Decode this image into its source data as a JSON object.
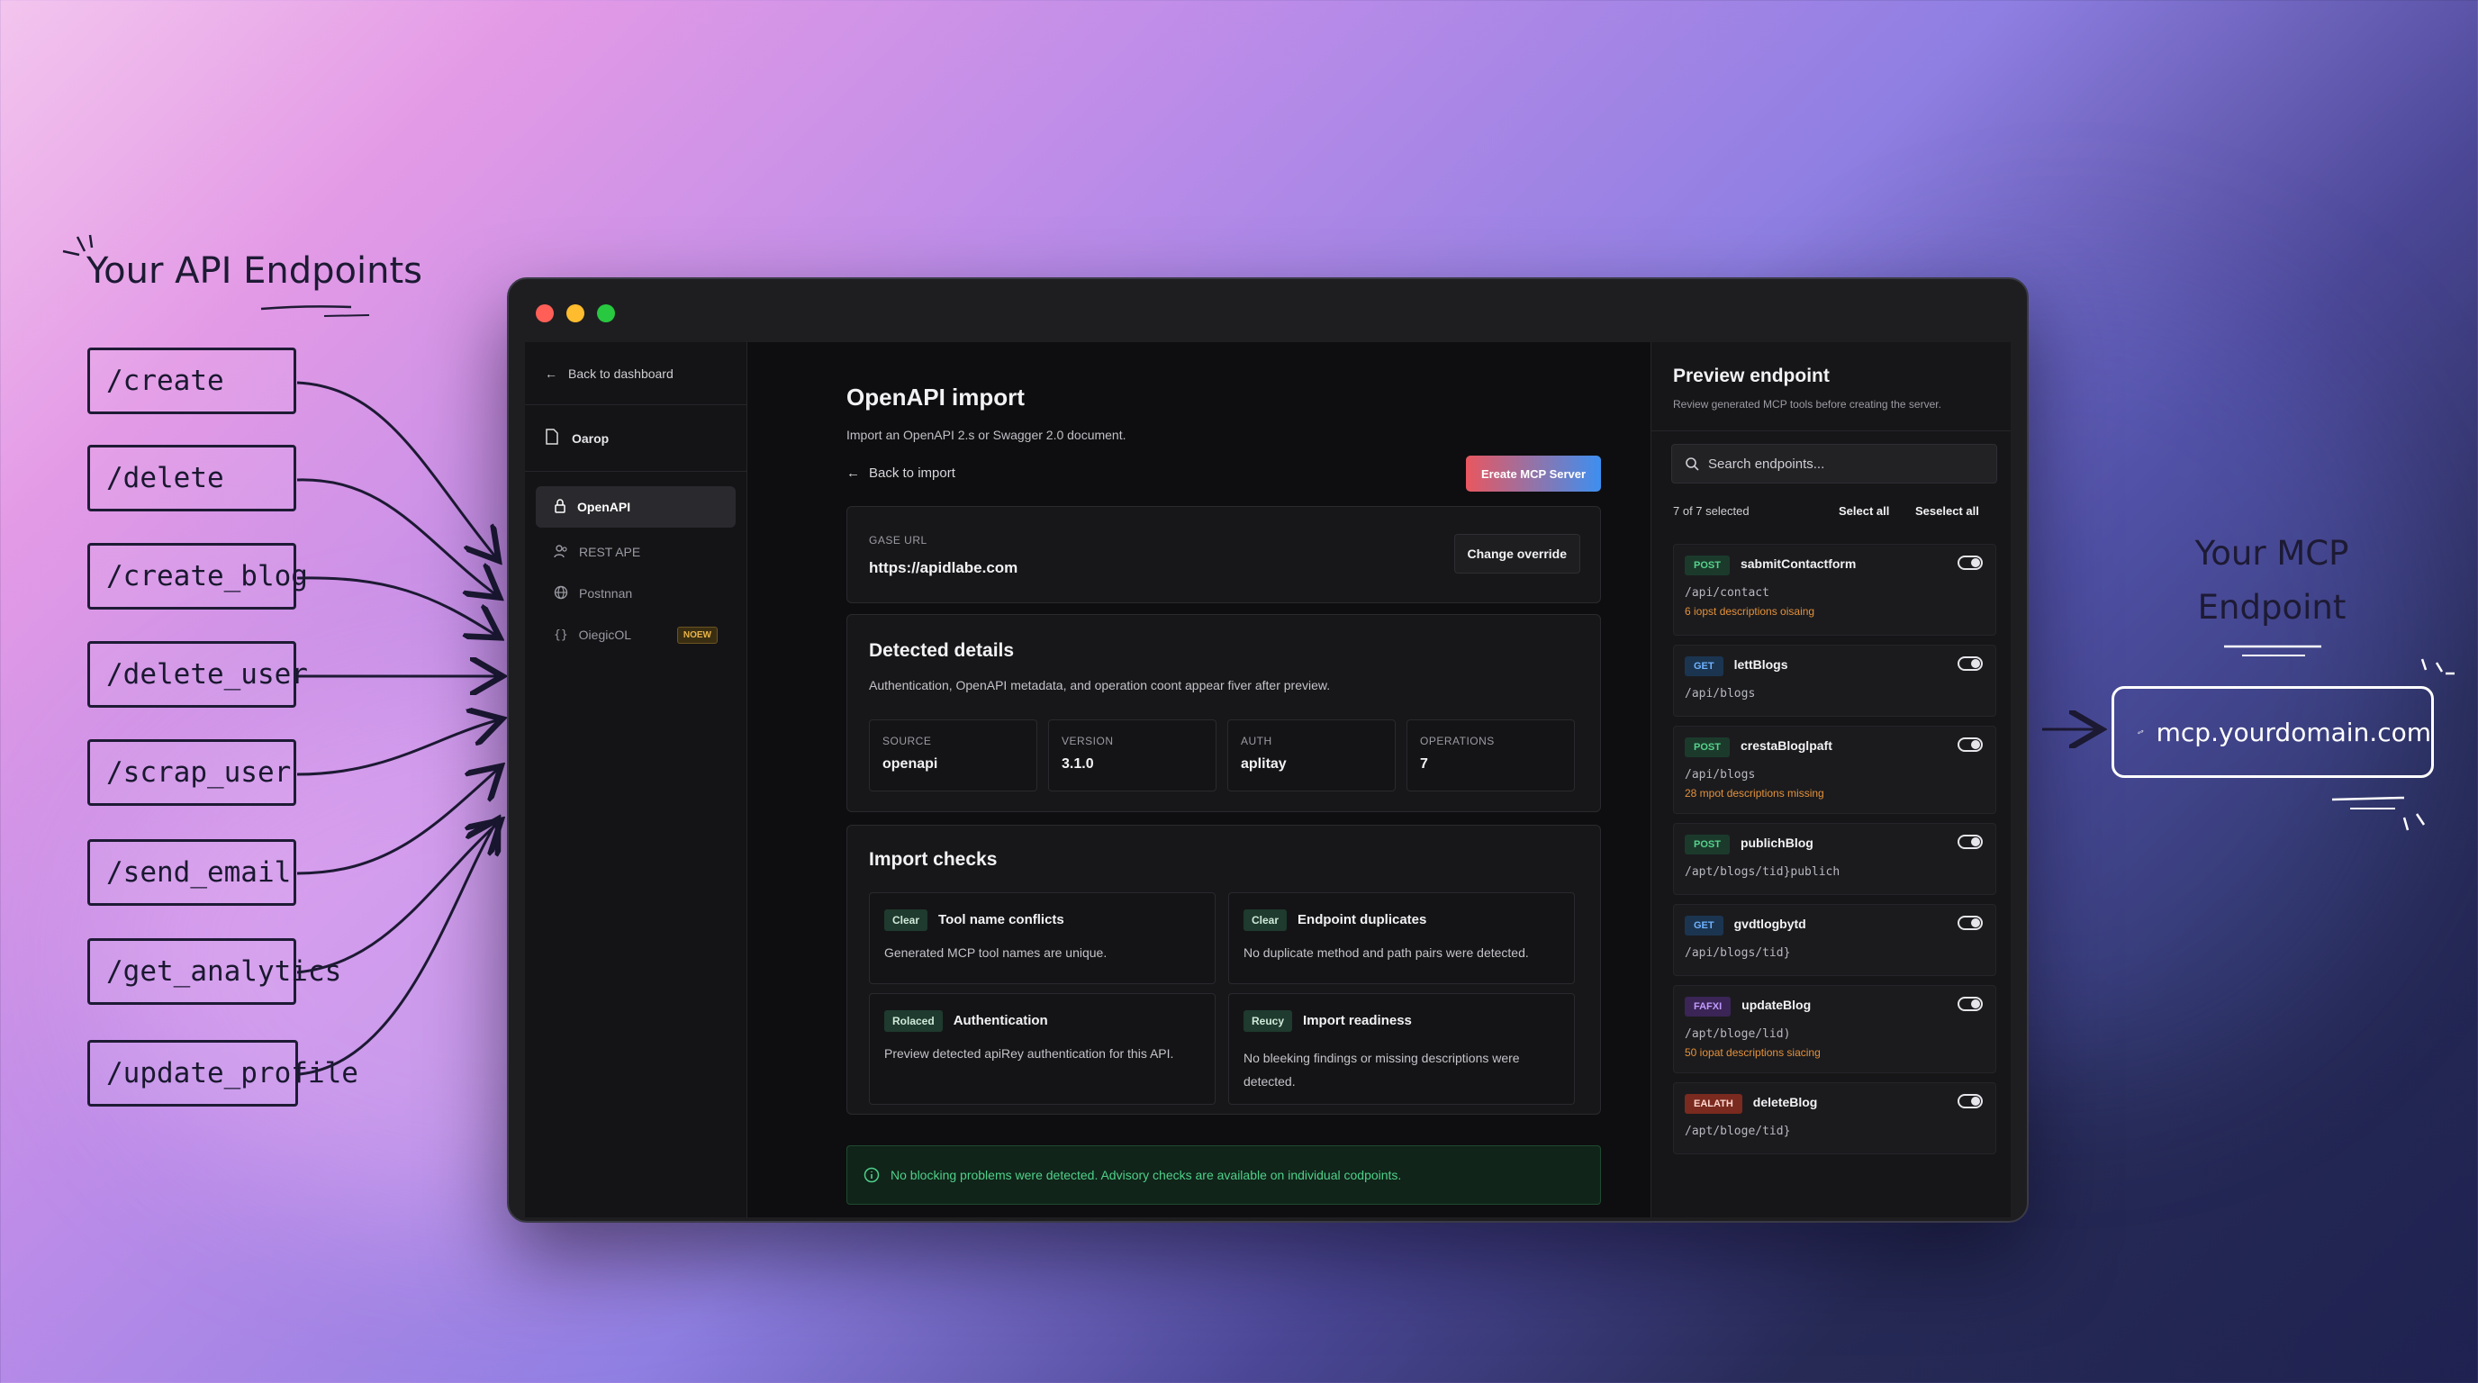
{
  "left_panel": {
    "title": "Your API Endpoints",
    "endpoints": [
      "/create",
      "/delete",
      "/create_blog",
      "/delete_user",
      "/scrap_user",
      "/send_email",
      "/get_analytics",
      "/update_profile"
    ]
  },
  "right_panel": {
    "title_line1": "Your MCP",
    "title_line2": "Endpoint",
    "domain": "mcp.yourdomain.com"
  },
  "sidebar": {
    "back_label": "Back to dashboard",
    "workspace": "Oarop",
    "items": [
      {
        "label": "OpenAPI",
        "icon": "lock-icon",
        "active": true
      },
      {
        "label": "REST APE",
        "icon": "people-icon"
      },
      {
        "label": "Postnnan",
        "icon": "globe-icon"
      },
      {
        "label": "OiegicOL",
        "icon": "braces-icon",
        "badge": "NOEW"
      }
    ]
  },
  "main": {
    "title": "OpenAPI import",
    "subtitle": "Import an OpenAPI 2.s or Swagger 2.0 document.",
    "back_label": "Back to import",
    "create_button": "Ereate MCP Server",
    "base_url_label": "GASE URL",
    "base_url": "https://apidlabe.com",
    "change_button": "Change override",
    "detected": {
      "title": "Detected details",
      "desc": "Authentication, OpenAPI metadata, and operation coont appear fiver after preview.",
      "stats": [
        {
          "label": "SOURCE",
          "value": "openapi"
        },
        {
          "label": "VERSION",
          "value": "3.1.0"
        },
        {
          "label": "AUTH",
          "value": "aplitay"
        },
        {
          "label": "OPERATIONS",
          "value": "7"
        }
      ]
    },
    "checks": {
      "title": "Import checks",
      "items": [
        {
          "badge": "Clear",
          "title": "Tool name conflicts",
          "desc": "Generated MCP tool names are unique."
        },
        {
          "badge": "Clear",
          "title": "Endpoint duplicates",
          "desc": "No duplicate method and path pairs were detected."
        },
        {
          "badge": "Rolaced",
          "title": "Authentication",
          "desc": "Preview detected apiRey authentication for this API."
        },
        {
          "badge": "Reucy",
          "title": "Import readiness",
          "desc": "No bleeking findings or missing descriptions were detected."
        }
      ]
    },
    "notice": "No blocking problems were detected. Advisory checks are available on individual codpoints."
  },
  "preview": {
    "title": "Preview endpoint",
    "subtitle": "Review generated MCP tools before creating the server.",
    "search_placeholder": "Search endpoints...",
    "selected_count": "7 of 7 selected",
    "select_all": "Select all",
    "deselect_all": "Seselect all",
    "endpoints": [
      {
        "method": "POST",
        "name": "sabmitContactform",
        "path": "/api/contact",
        "warning": "6 iopst descriptions oisaing"
      },
      {
        "method": "GET",
        "name": "lettBlogs",
        "path": "/api/blogs",
        "warning": ""
      },
      {
        "method": "POST",
        "name": "crestaBloglpaft",
        "path": "/api/blogs",
        "warning": "28 mpot descriptions missing"
      },
      {
        "method": "POST",
        "name": "publichBlog",
        "path": "/apt/blogs/tid}publich",
        "warning": ""
      },
      {
        "method": "GET",
        "name": "gvdtlogbytd",
        "path": "/api/blogs/tid}",
        "warning": ""
      },
      {
        "method": "FAFXI",
        "name": "updateBlog",
        "path": "/apt/bloge/lid)",
        "warning": "50 iopat descriptions siacing"
      },
      {
        "method": "EALATH",
        "name": "deleteBlog",
        "path": "/apt/bloge/tid}",
        "warning": ""
      }
    ]
  },
  "colors": {
    "post_bg": "#1c3a2c",
    "post_fg": "#55d38c",
    "get_bg": "#1b3550",
    "get_fg": "#6fb2ff",
    "patch_bg": "#3a2556",
    "patch_fg": "#c29bff",
    "delete_bg": "#7a2a1e",
    "delete_fg": "#ffd7cf",
    "accent_gradient_start": "#e9575f",
    "accent_gradient_end": "#3d8ff0"
  }
}
